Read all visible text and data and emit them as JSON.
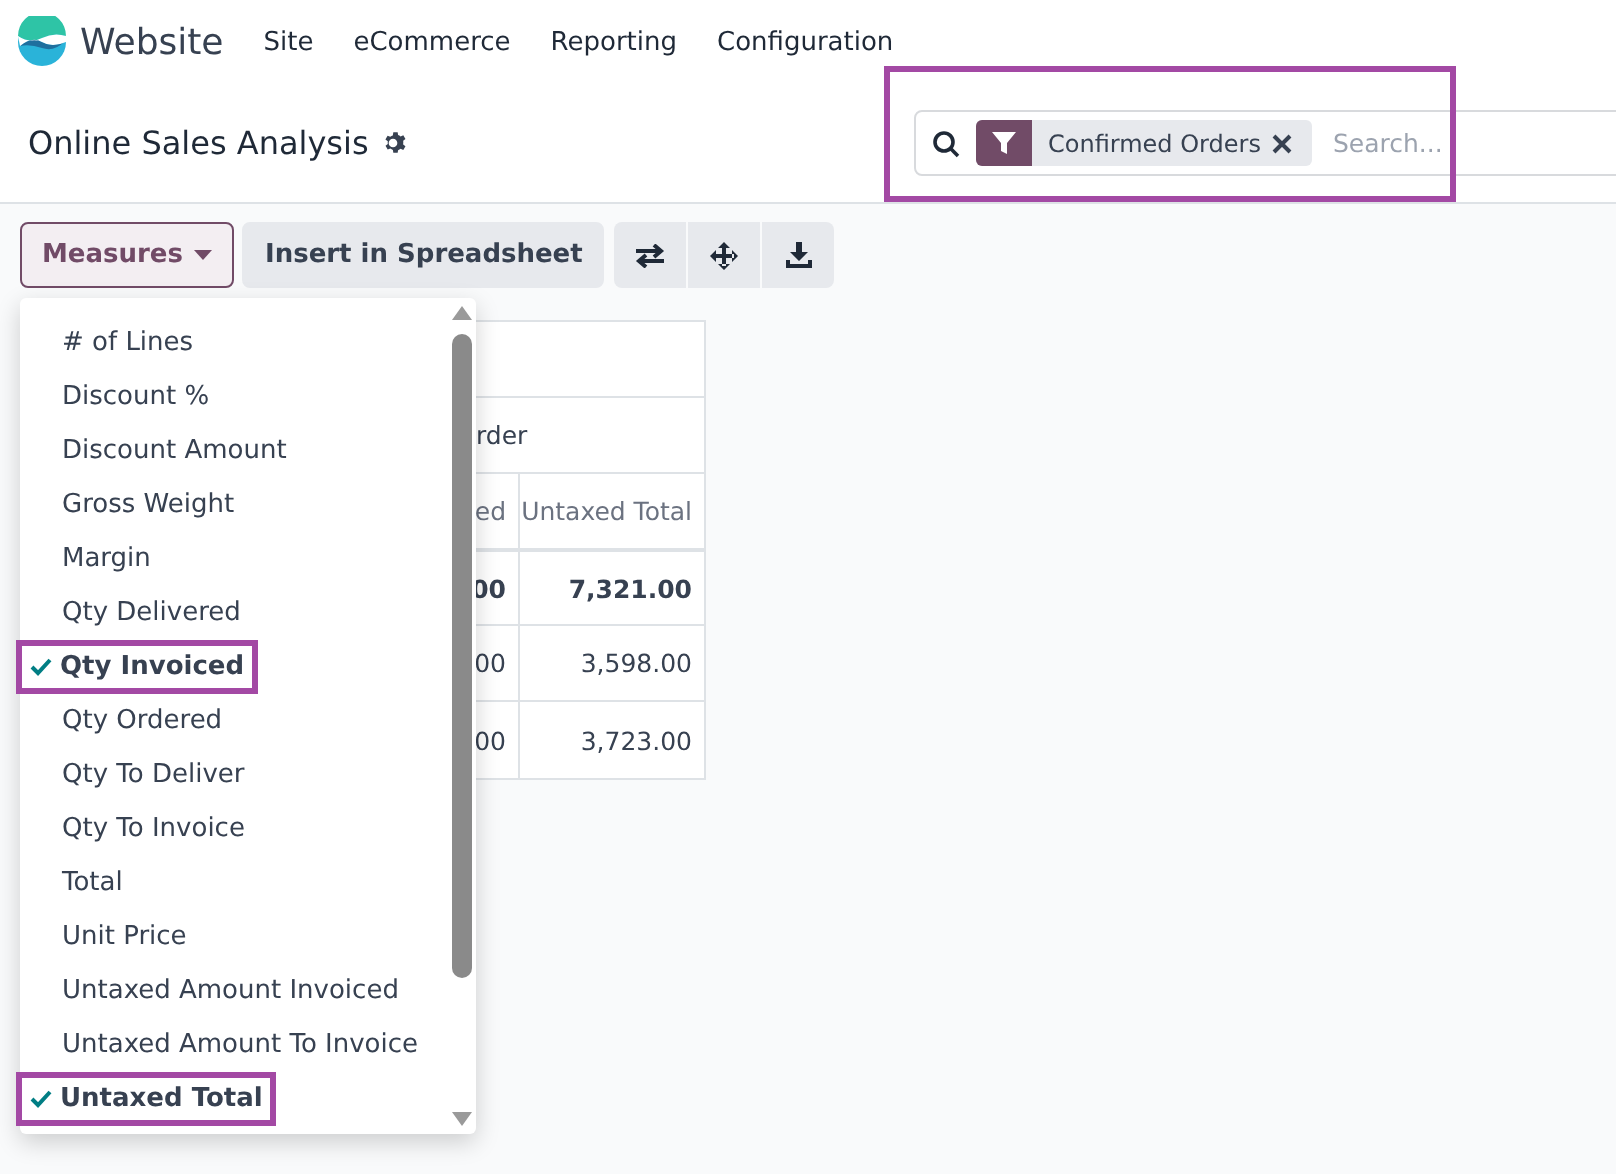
{
  "navbar": {
    "app_name": "Website",
    "menu": [
      "Site",
      "eCommerce",
      "Reporting",
      "Configuration"
    ]
  },
  "control_panel": {
    "title": "Online Sales Analysis",
    "search": {
      "highlighted": true,
      "facets": [
        {
          "label": "Confirmed Orders"
        }
      ],
      "placeholder": "Search..."
    }
  },
  "toolbar": {
    "measures_button": "Measures",
    "insert_button": "Insert in Spreadsheet"
  },
  "measures_menu": [
    {
      "label": "# of Lines",
      "checked": false,
      "highlighted": false
    },
    {
      "label": "Discount %",
      "checked": false,
      "highlighted": false
    },
    {
      "label": "Discount Amount",
      "checked": false,
      "highlighted": false
    },
    {
      "label": "Gross Weight",
      "checked": false,
      "highlighted": false
    },
    {
      "label": "Margin",
      "checked": false,
      "highlighted": false
    },
    {
      "label": "Qty Delivered",
      "checked": false,
      "highlighted": false
    },
    {
      "label": "Qty Invoiced",
      "checked": true,
      "highlighted": true
    },
    {
      "label": "Qty Ordered",
      "checked": false,
      "highlighted": false
    },
    {
      "label": "Qty To Deliver",
      "checked": false,
      "highlighted": false
    },
    {
      "label": "Qty To Invoice",
      "checked": false,
      "highlighted": false
    },
    {
      "label": "Total",
      "checked": false,
      "highlighted": false
    },
    {
      "label": "Unit Price",
      "checked": false,
      "highlighted": false
    },
    {
      "label": "Untaxed Amount Invoiced",
      "checked": false,
      "highlighted": false
    },
    {
      "label": "Untaxed Amount To Invoice",
      "checked": false,
      "highlighted": false
    },
    {
      "label": "Untaxed Total",
      "checked": true,
      "highlighted": true
    }
  ],
  "pivot": {
    "header_row_2": "rder",
    "columns": [
      "ed",
      "Untaxed Total"
    ],
    "rows": [
      {
        "bold": true,
        "cells": [
          "00",
          "7,321.00"
        ]
      },
      {
        "bold": false,
        "cells": [
          "00",
          "3,598.00"
        ]
      },
      {
        "bold": false,
        "cells": [
          "00",
          "3,723.00"
        ]
      }
    ]
  }
}
